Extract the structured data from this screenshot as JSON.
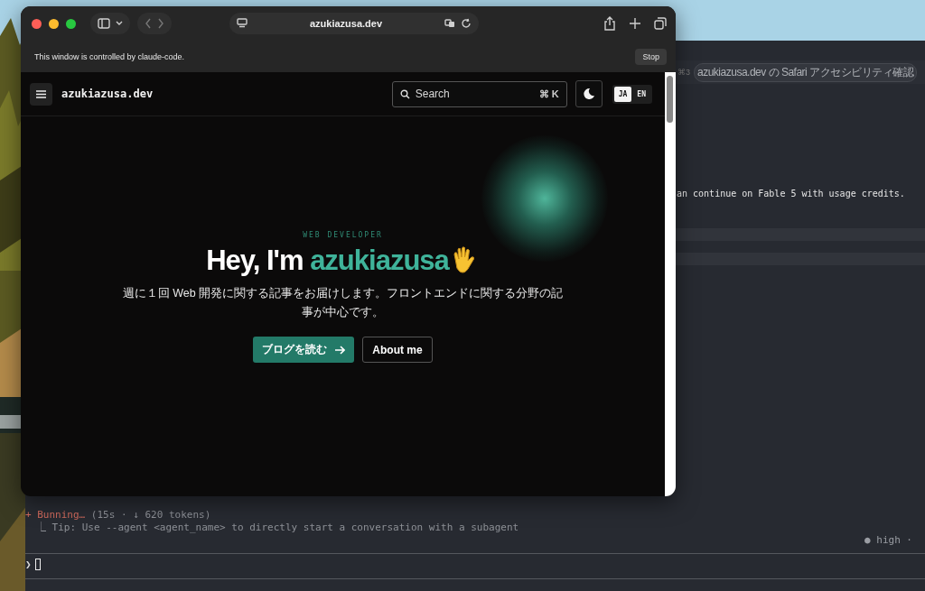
{
  "terminal": {
    "tab_shortcut": "⌘3",
    "tab_title": "azukiazusa.dev の Safari アクセシビリティ確認",
    "output_line": "an continue on Fable 5 with usage credits.",
    "status": {
      "spinner": "+ Bunning…",
      "detail": "(15s · ↓ 620 tokens)"
    },
    "tip": "⎿ Tip: Use --agent <agent_name> to directly start a conversation with a subagent",
    "effort": "● high ·",
    "prompt_symbol": "❯"
  },
  "browser": {
    "address": "azukiazusa.dev",
    "banner": "This window is controlled by claude-code.",
    "stop_button": "Stop",
    "site": {
      "name": "azukiazusa.dev",
      "search": {
        "placeholder": "Search",
        "shortcut": "⌘ K"
      },
      "languages": [
        {
          "label": "JA",
          "selected": true
        },
        {
          "label": "EN",
          "selected": false
        }
      ],
      "eyebrow": "WEB DEVELOPER",
      "heading": "Hey, I'm ",
      "heading_name": "azukiazusa",
      "intro": "週に１回 Web 開発に関する記事をお届けします。フロントエンドに関する分野の記事が中心です。",
      "buttons": [
        {
          "label": "ブログを読む",
          "kind": "primary"
        },
        {
          "label": "About me",
          "kind": "secondary"
        }
      ]
    }
  }
}
